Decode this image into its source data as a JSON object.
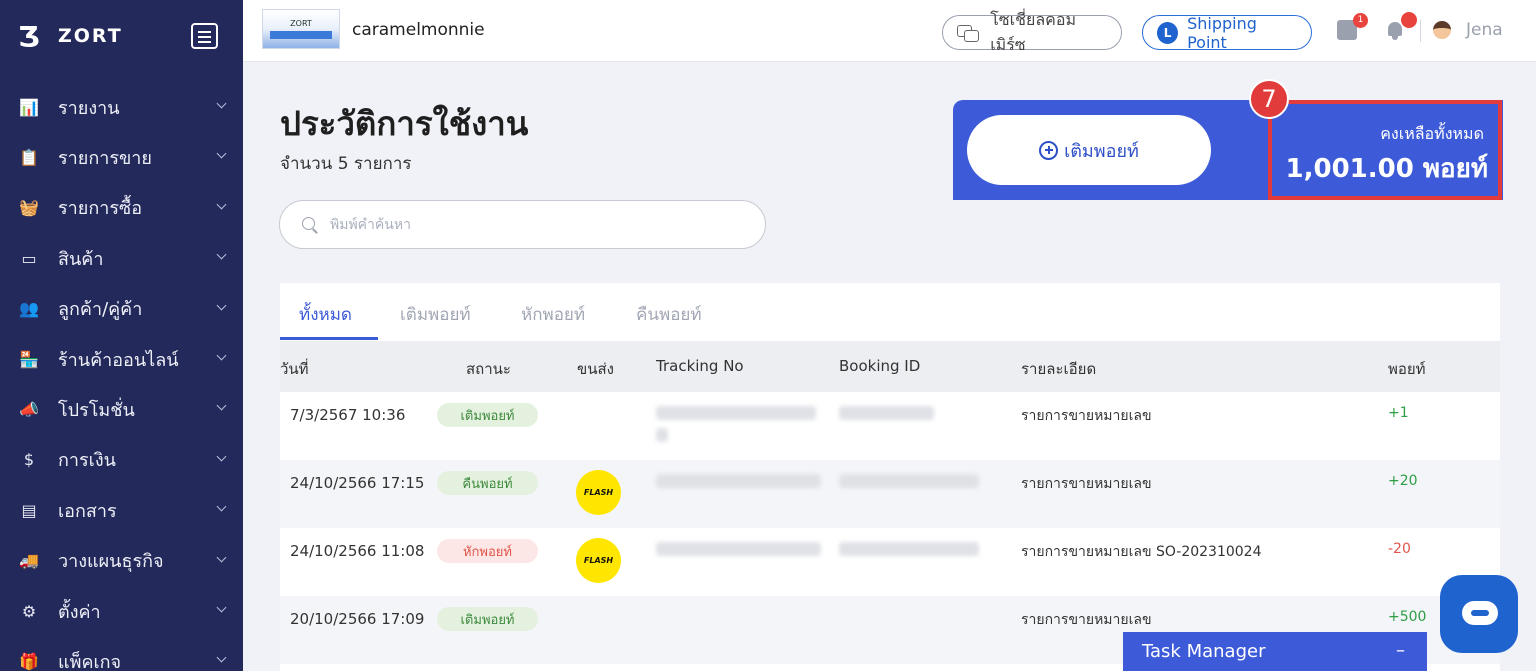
{
  "brand": {
    "name": "ZORT"
  },
  "sidebar": {
    "items": [
      {
        "label": "รายงาน",
        "icon": "chart-icon",
        "glyph": "📊"
      },
      {
        "label": "รายการขาย",
        "icon": "clipboard-icon",
        "glyph": "📋"
      },
      {
        "label": "รายการซื้อ",
        "icon": "basket-icon",
        "glyph": "🧺"
      },
      {
        "label": "สินค้า",
        "icon": "box-icon",
        "glyph": "▭"
      },
      {
        "label": "ลูกค้า/คู่ค้า",
        "icon": "users-icon",
        "glyph": "👥"
      },
      {
        "label": "ร้านค้าออนไลน์",
        "icon": "store-icon",
        "glyph": "🏪"
      },
      {
        "label": "โปรโมชั่น",
        "icon": "megaphone-icon",
        "glyph": "📣"
      },
      {
        "label": "การเงิน",
        "icon": "coin-icon",
        "glyph": "$"
      },
      {
        "label": "เอกสาร",
        "icon": "document-icon",
        "glyph": "▤"
      },
      {
        "label": "วางแผนธุรกิจ",
        "icon": "planning-icon",
        "glyph": "🚚"
      },
      {
        "label": "ตั้งค่า",
        "icon": "gear-icon",
        "glyph": "⚙"
      },
      {
        "label": "แพ็คเกจ",
        "icon": "package-icon",
        "glyph": "🎁"
      }
    ]
  },
  "topbar": {
    "shop_logo_text": "ZORT",
    "shop_name": "caramelmonnie",
    "social_label": "โซเชี่ยลคอมเมิร์ซ",
    "shipping_label": "Shipping Point",
    "shipping_icon_text": "L",
    "notification_count": "1",
    "user_name": "Jena"
  },
  "main": {
    "title": "ประวัติการใช้งาน",
    "count_text": "จำนวน 5 รายการ",
    "search_placeholder": "พิมพ์คำค้นหา"
  },
  "balance": {
    "topup_label": "เติมพอยท์",
    "label": "คงเหลือทั้งหมด",
    "value": "1,001.00 พอยท์",
    "step": "7"
  },
  "tabs": [
    {
      "label": "ทั้งหมด"
    },
    {
      "label": "เติมพอยท์"
    },
    {
      "label": "หักพอยท์"
    },
    {
      "label": "คืนพอยท์"
    }
  ],
  "table": {
    "headers": {
      "date": "วันที่",
      "status": "สถานะ",
      "carrier": "ขนส่ง",
      "tracking": "Tracking No",
      "booking": "Booking ID",
      "detail": "รายละเอียด",
      "points": "พอยท์"
    },
    "carrier_logo_text": "FLASH",
    "rows": [
      {
        "date": "7/3/2567 10:36",
        "status": "เติมพอยท์",
        "detail": "รายการขายหมายเลข",
        "points": "+1"
      },
      {
        "date": "24/10/2566 17:15",
        "status": "คืนพอยท์",
        "detail": "รายการขายหมายเลข",
        "points": "+20"
      },
      {
        "date": "24/10/2566 11:08",
        "status": "หักพอยท์",
        "detail": "รายการขายหมายเลข SO-202310024",
        "points": "-20"
      },
      {
        "date": "20/10/2566 17:09",
        "status": "เติมพอยท์",
        "detail": "รายการขายหมายเลข",
        "points": "+500"
      }
    ]
  },
  "task_manager": {
    "label": "Task Manager",
    "minimize": "–"
  }
}
